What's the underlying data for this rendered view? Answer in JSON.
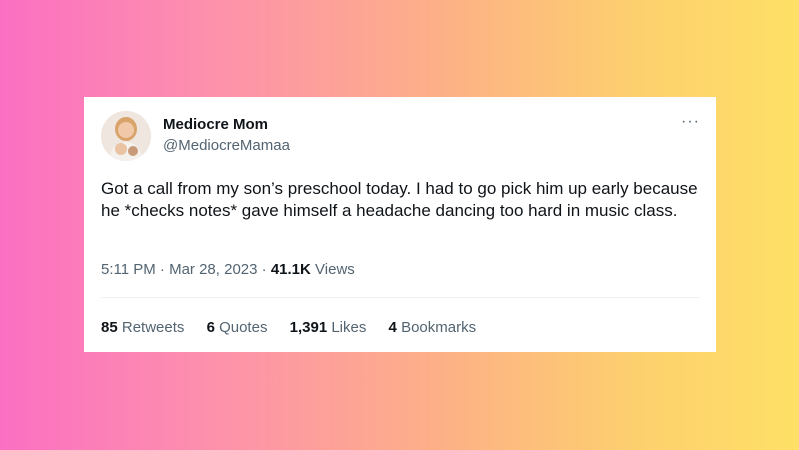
{
  "tweet": {
    "author_name": "Mediocre Mom",
    "author_handle": "@MediocreMamaa",
    "more_glyph": "···",
    "text": "Got a call from my son’s preschool today. I had to go pick him up early because he *checks notes* gave himself a headache dancing too hard in music class.",
    "time": "5:11 PM",
    "separator": "·",
    "date": "Mar 28, 2023",
    "views_count": "41.1K",
    "views_label": "Views"
  },
  "stats": {
    "retweets_count": "85",
    "retweets_label": "Retweets",
    "quotes_count": "6",
    "quotes_label": "Quotes",
    "likes_count": "1,391",
    "likes_label": "Likes",
    "bookmarks_count": "4",
    "bookmarks_label": "Bookmarks"
  },
  "colors": {
    "gradient_left": "#fb6fc2",
    "gradient_right": "#fee066",
    "text_primary": "#0f1419",
    "text_secondary": "#536471"
  }
}
